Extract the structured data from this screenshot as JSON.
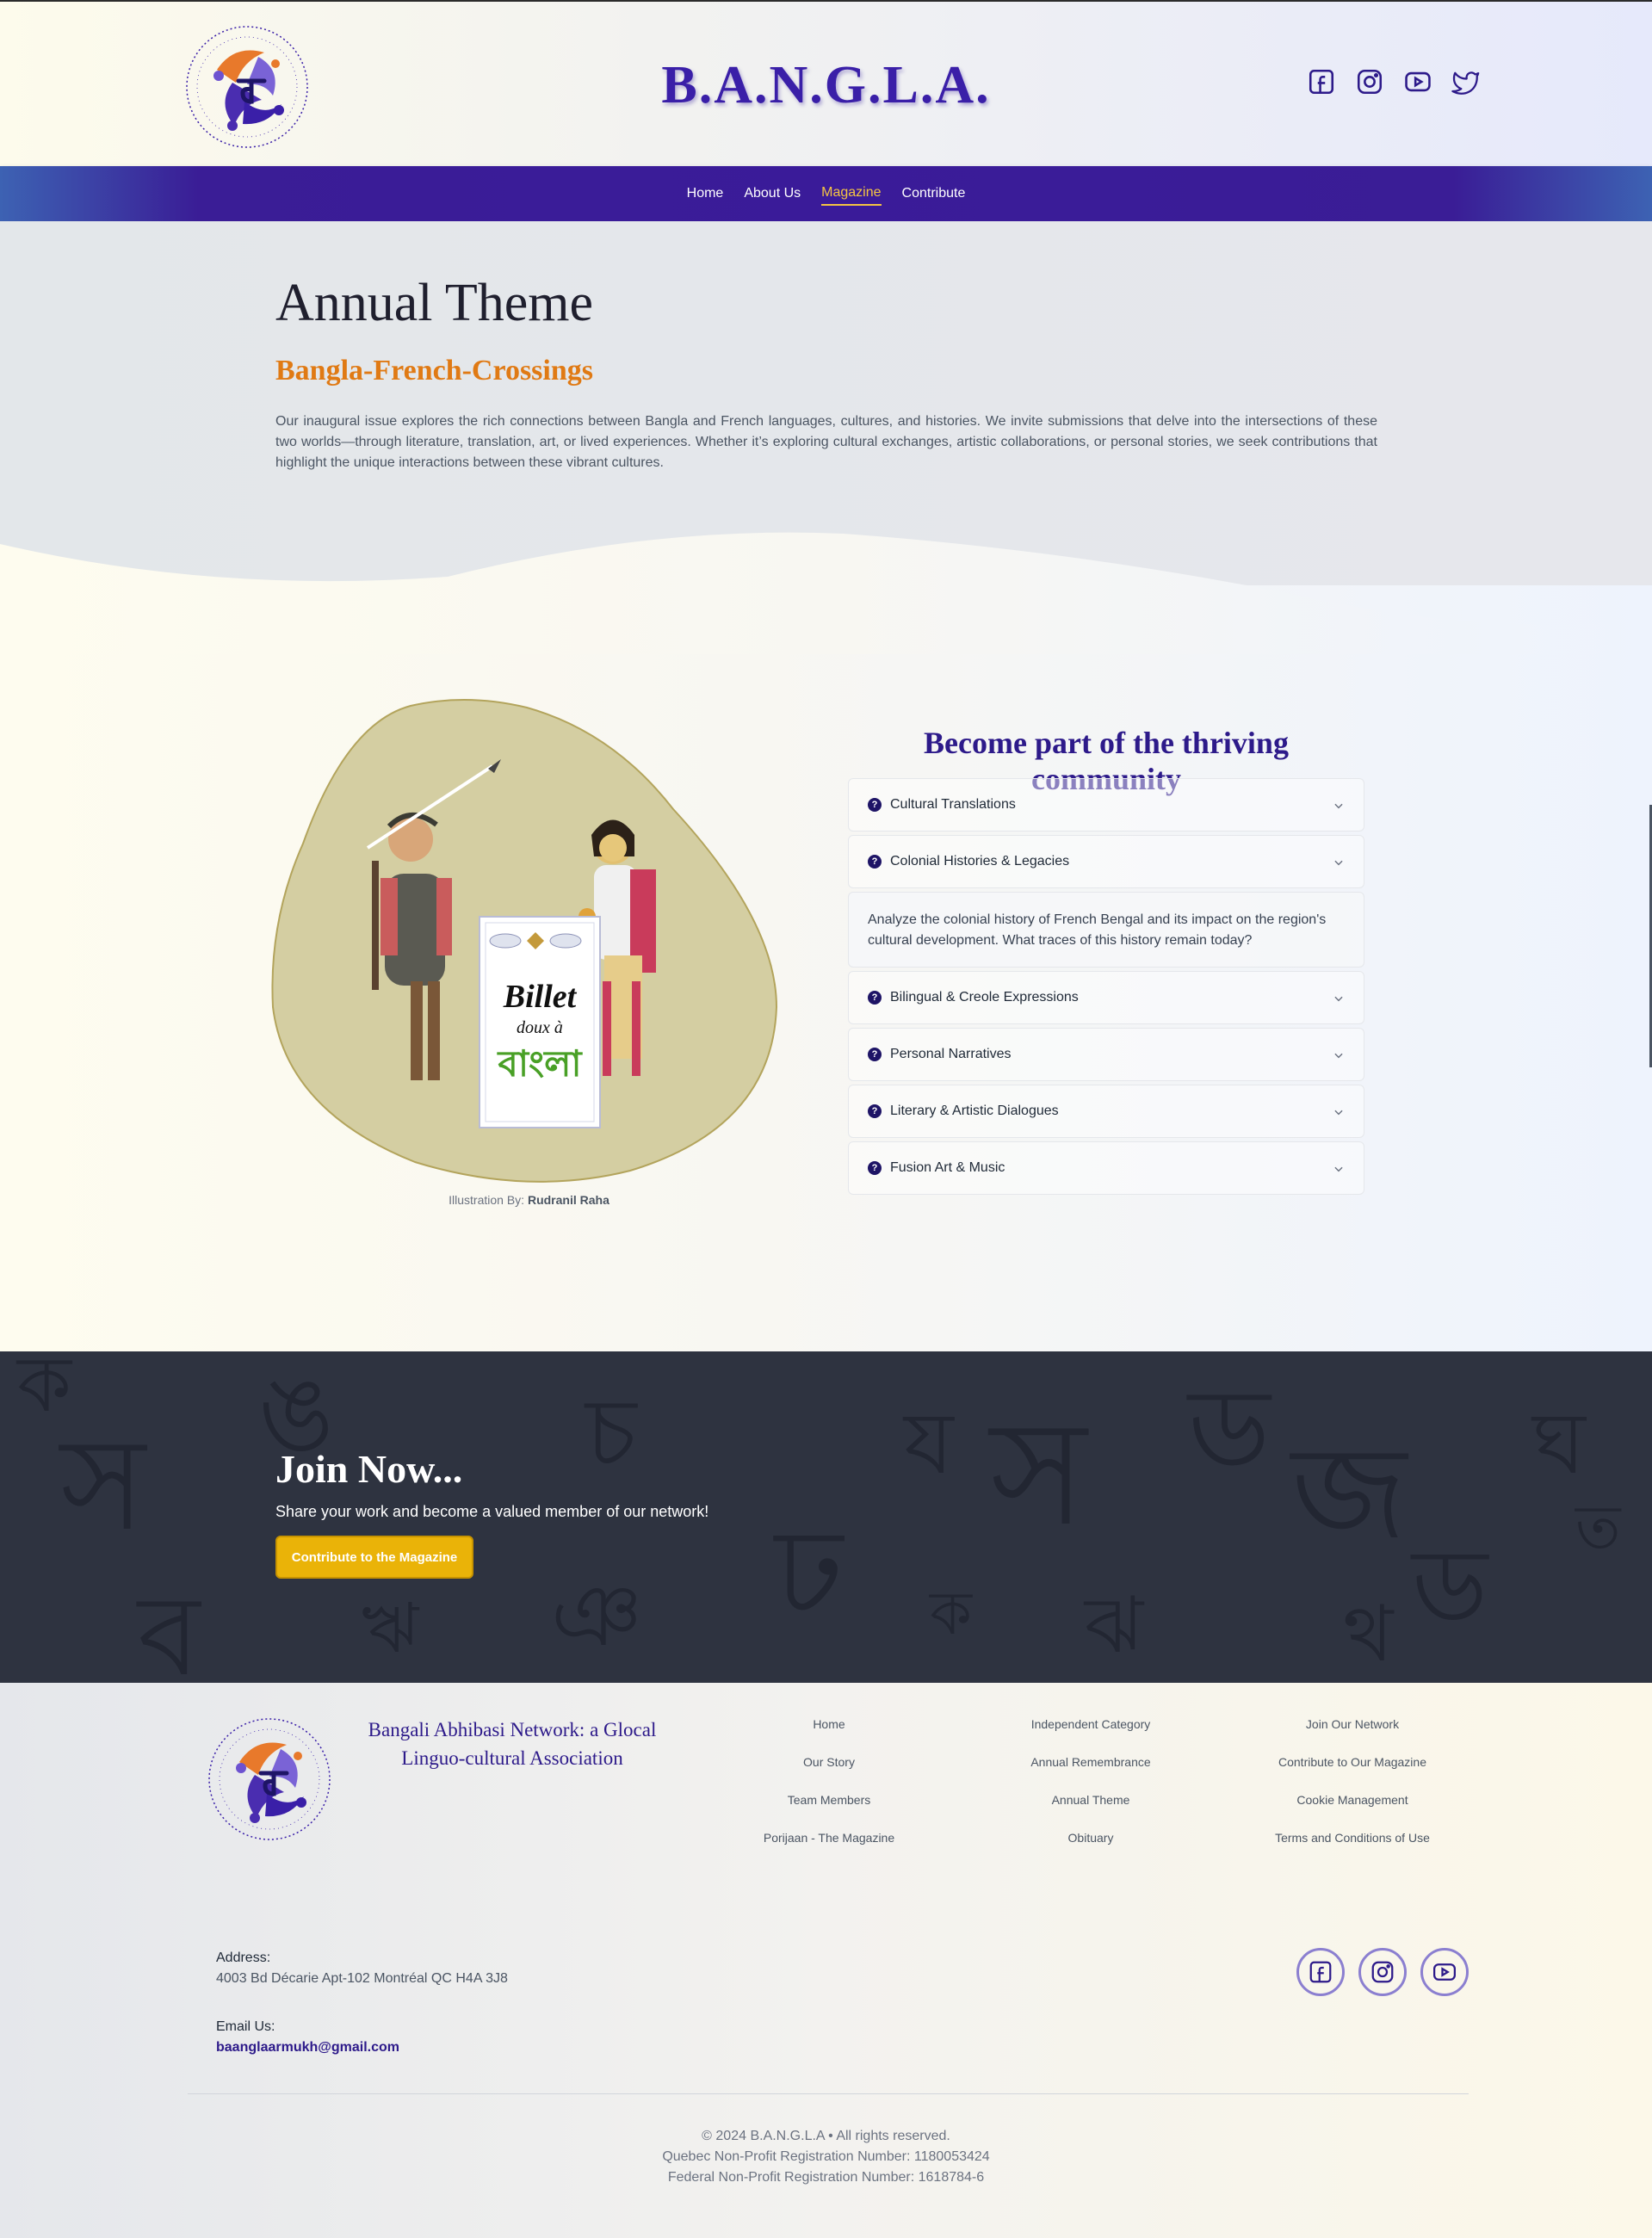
{
  "header": {
    "brand": "B.A.N.G.L.A.",
    "social": [
      "facebook-icon",
      "instagram-icon",
      "youtube-icon",
      "twitter-icon"
    ]
  },
  "nav": {
    "items": [
      {
        "label": "Home"
      },
      {
        "label": "About Us"
      },
      {
        "label": "Magazine",
        "active": true
      },
      {
        "label": "Contribute"
      }
    ]
  },
  "theme": {
    "title": "Annual Theme",
    "subtitle": "Bangla-French-Crossings",
    "description": "Our inaugural issue explores the rich connections between Bangla and French languages, cultures, and histories. We invite submissions that delve into the intersections of these two worlds—through literature, translation, art, or lived experiences. Whether it’s exploring cultural exchanges, artistic collaborations, or personal stories, we seek contributions that highlight the unique interactions between these vibrant cultures."
  },
  "illustration": {
    "card_line1": "Billet",
    "card_line2": "doux à",
    "card_line3": "বাংলা",
    "credit_prefix": "Illustration By:",
    "credit_name": "Rudranil Raha"
  },
  "community": {
    "title": "Become part of the thriving community",
    "items": [
      {
        "label": "Cultural Translations"
      },
      {
        "label": "Colonial Histories & Legacies",
        "expanded": true,
        "body": "Analyze the colonial history of French Bengal and its impact on the region's cultural development. What traces of this history remain today?"
      },
      {
        "label": "Bilingual & Creole Expressions"
      },
      {
        "label": "Personal Narratives"
      },
      {
        "label": "Literary & Artistic Dialogues"
      },
      {
        "label": "Fusion Art & Music"
      }
    ]
  },
  "join": {
    "title": "Join Now...",
    "text": "Share your work and become a valued member of our network!",
    "button": "Contribute to the Magazine"
  },
  "footer": {
    "org_name": "Bangali Abhibasi Network: a Glocal Linguo-cultural Association",
    "col1": [
      "Home",
      "Our Story",
      "Team Members",
      "Porijaan - The Magazine"
    ],
    "col2": [
      "Independent Category",
      "Annual Remembrance",
      "Annual Theme",
      "Obituary"
    ],
    "col3": [
      "Join Our Network",
      "Contribute to Our Magazine",
      "Cookie Management",
      "Terms and Conditions of Use"
    ],
    "address_label": "Address:",
    "address": "4003 Bd Décarie Apt-102 Montréal QC H4A 3J8",
    "email_label": "Email Us:",
    "email": "baanglaarmukh@gmail.com",
    "social": [
      "facebook-icon",
      "instagram-icon",
      "youtube-icon"
    ],
    "copyright": "© 2024 B.A.N.G.L.A • All rights reserved.",
    "quebec_reg": "Quebec Non-Profit Registration Number: 1180053424",
    "federal_reg": "Federal Non-Profit Registration Number: 1618784-6"
  },
  "colors": {
    "brand_purple": "#3a1fa8",
    "nav_bg": "#3a1b99",
    "accent_orange": "#e07a14",
    "button_yellow": "#eab308",
    "join_bg": "#2e3340"
  }
}
